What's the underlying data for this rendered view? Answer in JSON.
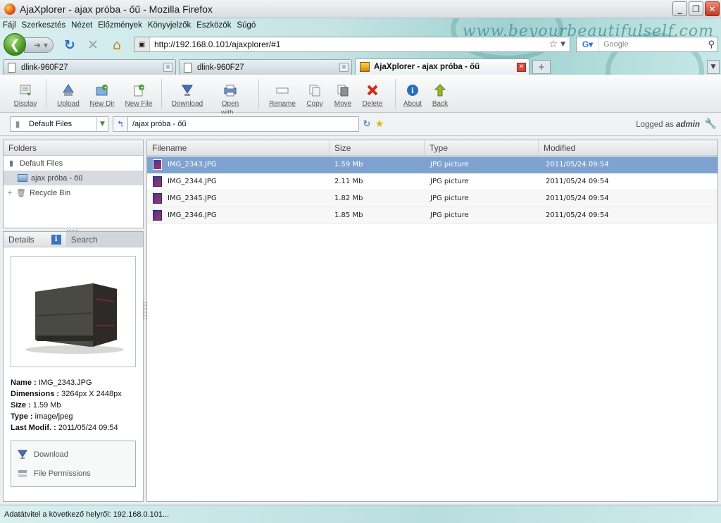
{
  "window": {
    "title": "AjaXplorer - ajax próba - őű - Mozilla Firefox"
  },
  "menu": [
    "Fájl",
    "Szerkesztés",
    "Nézet",
    "Előzmények",
    "Könyvjelzők",
    "Eszközök",
    "Súgó"
  ],
  "watermark": "www.beyourbeautifulself.com",
  "nav": {
    "url": "http://192.168.0.101/ajaxplorer/#1",
    "search_placeholder": "Google"
  },
  "tabs": [
    {
      "label": "dlink-960F27"
    },
    {
      "label": "dlink-960F27"
    },
    {
      "label": "AjaXplorer - ajax próba - őű"
    }
  ],
  "toolbar": {
    "buttons": [
      {
        "label": "Display"
      },
      {
        "label": "Upload"
      },
      {
        "label": "New Dir"
      },
      {
        "label": "New File"
      },
      {
        "label": "Download"
      },
      {
        "label": "Open with..."
      },
      {
        "label": "Rename"
      },
      {
        "label": "Copy"
      },
      {
        "label": "Move"
      },
      {
        "label": "Delete"
      },
      {
        "label": "About"
      },
      {
        "label": "Back"
      }
    ]
  },
  "location": {
    "repository": "Default Files",
    "path": "/ajax próba - őű",
    "logged_prefix": "Logged as",
    "user": "admin"
  },
  "folders": {
    "title": "Folders",
    "items": [
      "Default Files",
      "ajax próba - őű",
      "Recycle Bin"
    ]
  },
  "details": {
    "tab_details": "Details",
    "tab_search": "Search",
    "meta": [
      {
        "label": "Name :",
        "value": "IMG_2343.JPG"
      },
      {
        "label": "Dimensions :",
        "value": "3264px X 2448px"
      },
      {
        "label": "Size :",
        "value": "1.59 Mb"
      },
      {
        "label": "Type :",
        "value": "image/jpeg"
      },
      {
        "label": "Last Modif. :",
        "value": "2011/05/24 09:54"
      }
    ],
    "actions": [
      "Download",
      "File Permissions"
    ]
  },
  "filelist": {
    "columns": [
      "Filename",
      "Size",
      "Type",
      "Modified"
    ],
    "rows": [
      {
        "name": "IMG_2343.JPG",
        "size": "1.59 Mb",
        "type": "JPG picture",
        "modified": "2011/05/24 09:54"
      },
      {
        "name": "IMG_2344.JPG",
        "size": "2.11 Mb",
        "type": "JPG picture",
        "modified": "2011/05/24 09:54"
      },
      {
        "name": "IMG_2345.JPG",
        "size": "1.82 Mb",
        "type": "JPG picture",
        "modified": "2011/05/24 09:54"
      },
      {
        "name": "IMG_2346.JPG",
        "size": "1.85 Mb",
        "type": "JPG picture",
        "modified": "2011/05/24 09:54"
      }
    ]
  },
  "status": "Adatátvitel a következő helyről: 192.168.0.101..."
}
